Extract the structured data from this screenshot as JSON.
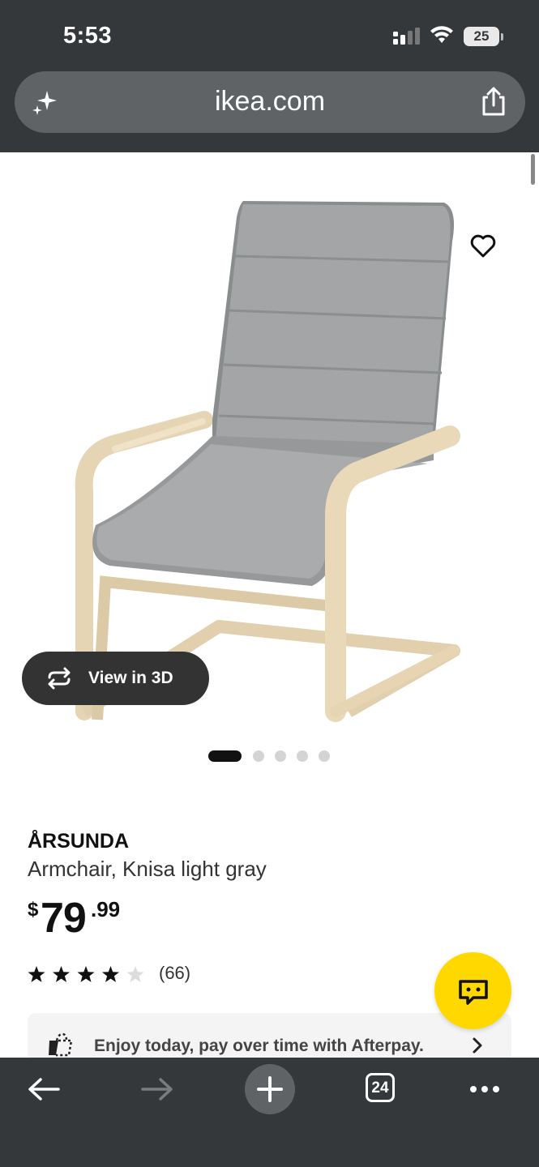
{
  "status": {
    "time": "5:53",
    "battery": "25",
    "icons": [
      "signal-icon",
      "wifi-icon",
      "battery-icon"
    ]
  },
  "browser": {
    "url": "ikea.com",
    "icons": [
      "sparkle-icon",
      "share-icon"
    ]
  },
  "product": {
    "image": "armchair-image",
    "name": "ÅRSUNDA",
    "description": "Armchair, Knisa light gray",
    "price": {
      "currency": "$",
      "integer": "79",
      "decimal": ".99"
    },
    "rating": {
      "stars": 4,
      "max": 5,
      "count": "(66)"
    }
  },
  "gallery": {
    "view3d_label": "View in 3D",
    "slides": 5,
    "active": 0
  },
  "afterpay": {
    "text": "Enjoy today, pay over time with Afterpay."
  },
  "toolbar": {
    "tabs_count": "24",
    "icons": [
      "back-icon",
      "forward-icon",
      "new-tab-icon",
      "tabs-icon",
      "more-icon"
    ]
  },
  "colors": {
    "chrome": "#34383b",
    "chat_button": "#ffd800",
    "url_bar": "#5f6366"
  }
}
